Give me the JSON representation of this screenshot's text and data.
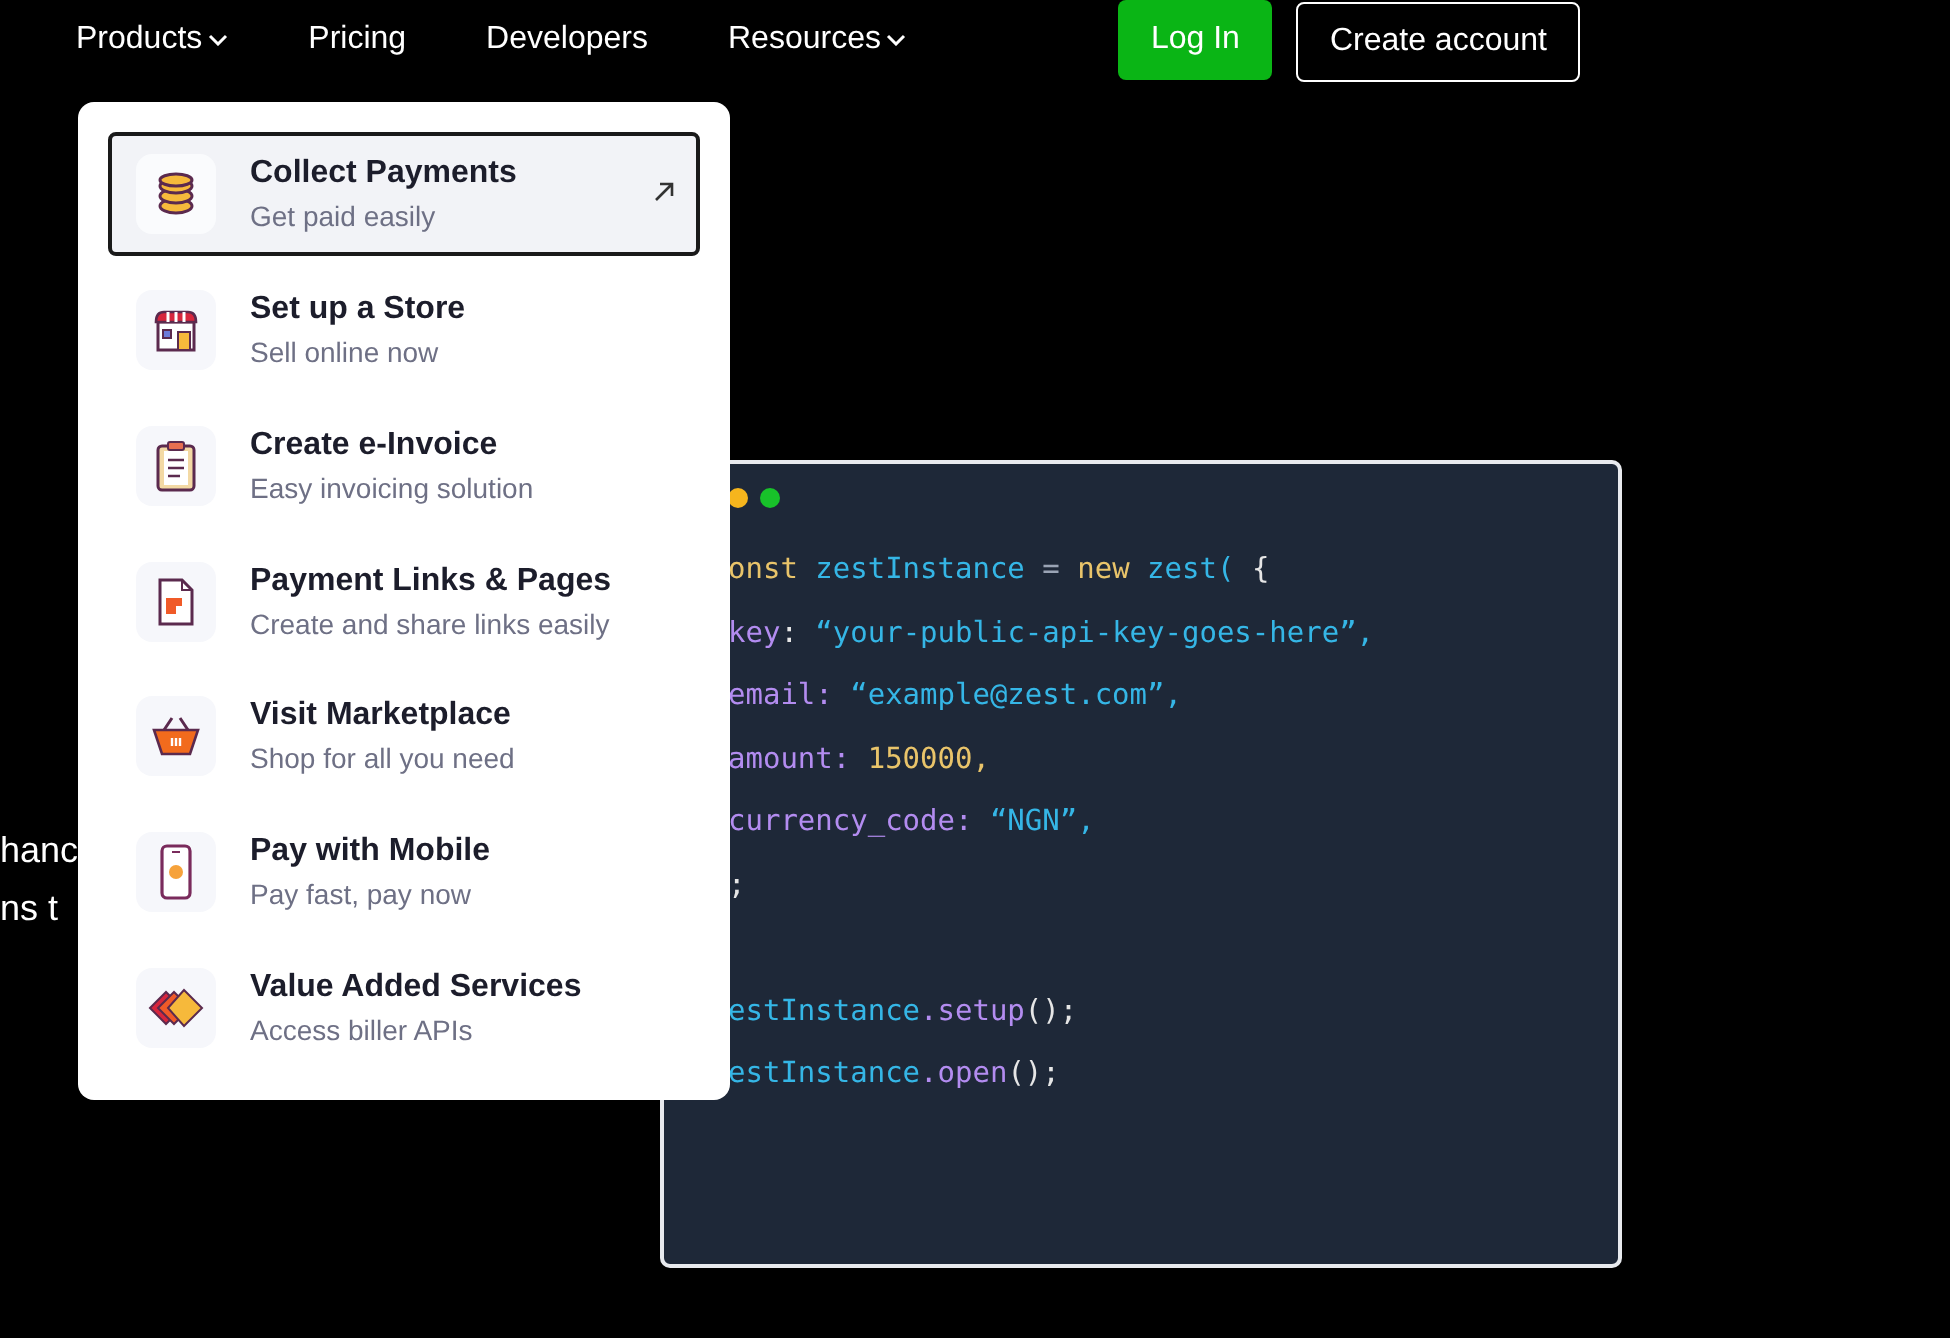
{
  "nav": {
    "links": [
      {
        "label": "Products",
        "dropdown": true
      },
      {
        "label": "Pricing",
        "dropdown": false
      },
      {
        "label": "Developers",
        "dropdown": false
      },
      {
        "label": "Resources",
        "dropdown": true
      }
    ],
    "buttons": [
      {
        "label": "Log In",
        "kind": "primary"
      },
      {
        "label": "Create account",
        "kind": "outline"
      }
    ]
  },
  "products_menu": {
    "items": [
      {
        "title": "Collect Payments",
        "subtitle": "Get paid easily",
        "kind": "coins",
        "selected": true
      },
      {
        "title": "Set up a Store",
        "subtitle": "Sell online now",
        "kind": "store",
        "selected": false
      },
      {
        "title": "Create e-Invoice",
        "subtitle": "Easy invoicing solution",
        "kind": "clipboard",
        "selected": false
      },
      {
        "title": "Payment Links & Pages",
        "subtitle": "Create and share links easily",
        "kind": "document",
        "selected": false
      },
      {
        "title": "Visit Marketplace",
        "subtitle": "Shop for all you need",
        "kind": "basket",
        "selected": false
      },
      {
        "title": "Pay with Mobile",
        "subtitle": "Pay fast, pay now",
        "kind": "phone",
        "selected": false
      },
      {
        "title": "Value Added Services",
        "subtitle": "Access biller APIs",
        "kind": "diamonds",
        "selected": false
      }
    ]
  },
  "hero_text": [
    "hanc",
    "ns t"
  ],
  "code": {
    "lines": [
      {
        "tokens": [
          {
            "text": "onst ",
            "kind": "keyword"
          },
          {
            "text": "zestInstance ",
            "kind": "ident"
          },
          {
            "text": "= ",
            "kind": "op"
          },
          {
            "text": "new ",
            "kind": "keyword"
          },
          {
            "text": "zest( ",
            "kind": "ident"
          },
          {
            "text": "{",
            "kind": "punct"
          }
        ]
      },
      {
        "tokens": [
          {
            "text": "key",
            "kind": "prop"
          },
          {
            "text": ": ",
            "kind": "punct"
          },
          {
            "text": "“your-public-api-key-goes-here”,",
            "kind": "string"
          }
        ]
      },
      {
        "tokens": [
          {
            "text": "email: ",
            "kind": "prop"
          },
          {
            "text": "“example@zest.com”,",
            "kind": "string"
          }
        ]
      },
      {
        "tokens": [
          {
            "text": "amount: ",
            "kind": "prop"
          },
          {
            "text": "150000,",
            "kind": "number"
          }
        ]
      },
      {
        "tokens": [
          {
            "text": "currency_code: ",
            "kind": "prop"
          },
          {
            "text": "“NGN”,",
            "kind": "string"
          }
        ]
      },
      {
        "tokens": [
          {
            "text": ";",
            "kind": "punct"
          }
        ]
      },
      {
        "blank_before": true,
        "tokens": [
          {
            "text": "estInstance",
            "kind": "ident"
          },
          {
            "text": ".setup",
            "kind": "prop"
          },
          {
            "text": "();",
            "kind": "punct"
          }
        ]
      },
      {
        "tokens": [
          {
            "text": "estInstance",
            "kind": "ident"
          },
          {
            "text": ".open",
            "kind": "prop"
          },
          {
            "text": "();",
            "kind": "punct"
          }
        ]
      }
    ]
  }
}
